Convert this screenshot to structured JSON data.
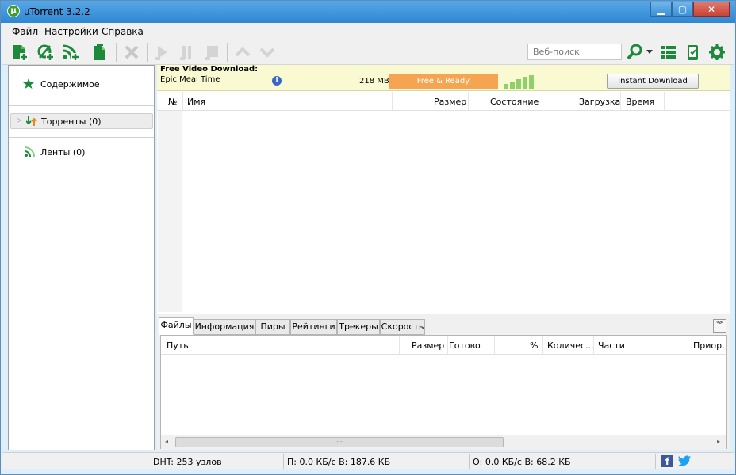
{
  "window": {
    "title": "µTorrent 3.2.2",
    "minimize": "▁",
    "maximize": "▢",
    "close": "✕"
  },
  "menu": [
    "Файл",
    "Настройки",
    "Справка"
  ],
  "toolbar": {
    "search_placeholder": "Веб-поиск",
    "icons": [
      "add-torrent-icon",
      "add-url-icon",
      "add-rss-icon",
      "create-torrent-icon",
      "remove-icon",
      "start-icon",
      "pause-icon",
      "stop-icon",
      "move-up-icon",
      "move-down-icon",
      "search-icon",
      "list-view-icon",
      "remote-icon",
      "settings-icon"
    ],
    "accent": "#1c8a3a"
  },
  "sidebar": {
    "items": [
      {
        "label": "Содержимое",
        "icon": "star-icon"
      },
      {
        "label": "Торренты (0)",
        "icon": "torrents-icon"
      },
      {
        "label": "Ленты (0)",
        "icon": "rss-feed-icon"
      }
    ]
  },
  "ad": {
    "title": "Free Video Download:",
    "subtitle": "Epic Meal Time",
    "size": "218 MB",
    "status": "Free & Ready",
    "button": "Instant Download",
    "status_color": "#f5a452"
  },
  "torrent_list": {
    "columns": [
      "№",
      "Имя",
      "Размер",
      "Состояние",
      "Загрузка",
      "Время"
    ],
    "rows": []
  },
  "detail_tabs": [
    "Файлы",
    "Информация",
    "Пиры",
    "Рейтинги",
    "Трекеры",
    "Скорость"
  ],
  "active_tab": "Файлы",
  "files_table": {
    "columns": [
      "Путь",
      "Размер",
      "Готово",
      "%",
      "Количес...",
      "Части",
      "Приор."
    ],
    "rows": []
  },
  "statusbar": {
    "dht": "DHT: 253 узлов",
    "download": "П: 0.0 КБ/с В: 187.6 КБ",
    "upload": "О: 0.0 КБ/с В: 68.2 КБ",
    "facebook": "f"
  }
}
